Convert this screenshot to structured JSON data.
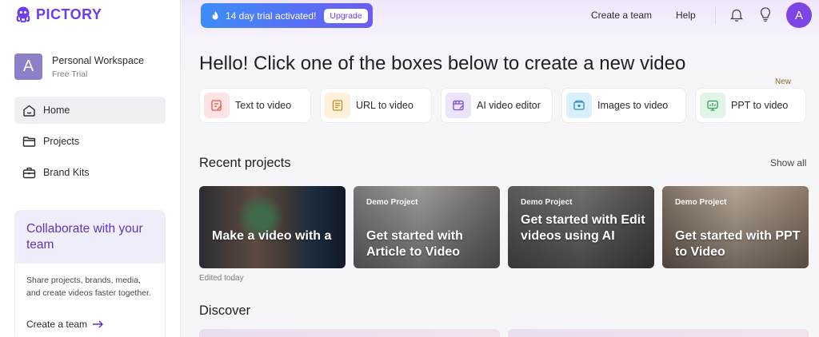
{
  "brand": {
    "name": "PICTORY",
    "color": "#6b3cf2"
  },
  "workspace": {
    "initial": "A",
    "name": "Personal Workspace",
    "plan": "Free Trial"
  },
  "sidebar": {
    "items": [
      {
        "label": "Home",
        "icon": "home-icon",
        "active": true
      },
      {
        "label": "Projects",
        "icon": "folder-icon",
        "active": false
      },
      {
        "label": "Brand Kits",
        "icon": "briefcase-icon",
        "active": false
      }
    ]
  },
  "collab": {
    "title": "Collaborate with your team",
    "body": "Share projects, brands, media, and create videos faster together.",
    "link": "Create a team"
  },
  "topbar": {
    "trial_text": "14 day trial activated!",
    "upgrade": "Upgrade",
    "create_team": "Create a team",
    "help": "Help",
    "avatar_initial": "A"
  },
  "main": {
    "hero": "Hello! Click one of the boxes below to create a new video",
    "actions": [
      {
        "label": "Text to video",
        "icon": "text-to-video-icon",
        "bg": "#fde3e3",
        "color": "#e2574c"
      },
      {
        "label": "URL to video",
        "icon": "url-to-video-icon",
        "bg": "#fdf1dc",
        "color": "#c98a1e"
      },
      {
        "label": "AI video editor",
        "icon": "ai-video-editor-icon",
        "bg": "#ece4fb",
        "color": "#7a4bd8"
      },
      {
        "label": "Images to video",
        "icon": "images-to-video-icon",
        "bg": "#d9f0fb",
        "color": "#2a8fc4"
      },
      {
        "label": "PPT to video",
        "icon": "ppt-to-video-icon",
        "bg": "#e0f5e8",
        "color": "#2f9e5a",
        "badge": "New"
      }
    ],
    "recent_title": "Recent projects",
    "show_all": "Show all",
    "projects": [
      {
        "tag": "",
        "title": "Make a video with a"
      },
      {
        "tag": "Demo Project",
        "title": "Get started with Article to Video"
      },
      {
        "tag": "Demo Project",
        "title": "Get started with Edit videos using AI"
      },
      {
        "tag": "Demo Project",
        "title": "Get started with PPT to Video"
      }
    ],
    "edited": "Edited today",
    "discover_title": "Discover"
  }
}
